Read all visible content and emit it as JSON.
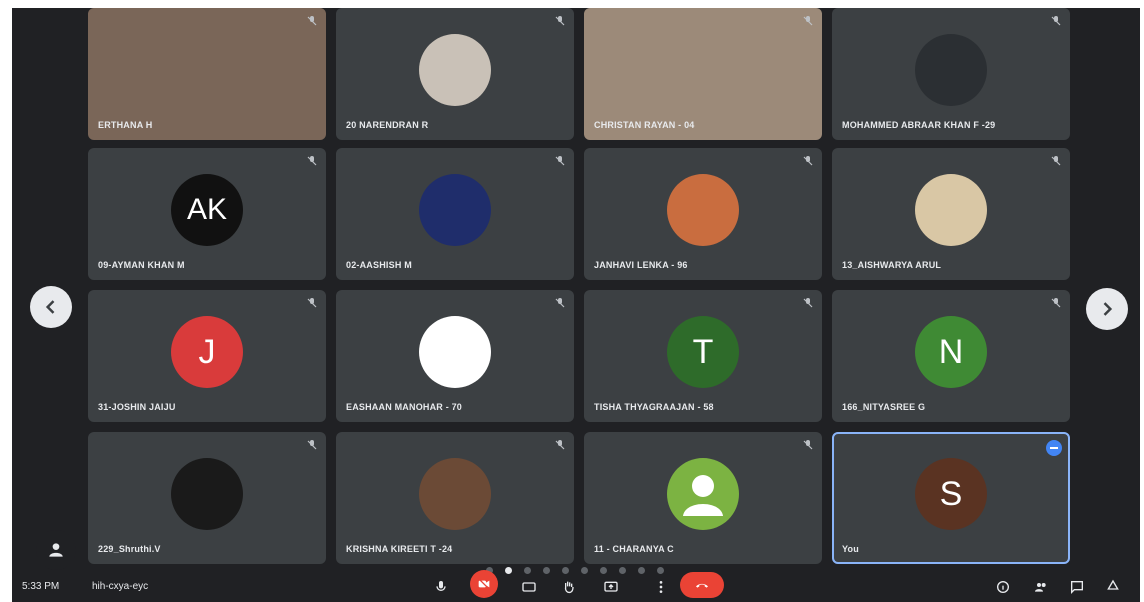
{
  "tiles": [
    {
      "name": "ERTHANA H",
      "kind": "video",
      "color": "#7a6658"
    },
    {
      "name": "20 NARENDRAN R",
      "kind": "photo",
      "avatar_color": "#c9c1b7"
    },
    {
      "name": "CHRISTAN RAYAN - 04",
      "kind": "video",
      "color": "#9c8a79"
    },
    {
      "name": "MOHAMMED ABRAAR KHAN F -29",
      "kind": "photo",
      "avatar_color": "#2b2f33"
    },
    {
      "name": "09-AYMAN KHAN M",
      "kind": "letter",
      "letter": "AK",
      "avatar_color": "#111111"
    },
    {
      "name": "02-AASHISH M",
      "kind": "photo",
      "avatar_color": "#1f2d6b"
    },
    {
      "name": "JANHAVI LENKA - 96",
      "kind": "photo",
      "avatar_color": "#c96d3f"
    },
    {
      "name": "13_AISHWARYA ARUL",
      "kind": "photo",
      "avatar_color": "#d9c7a5"
    },
    {
      "name": "31-JOSHIN JAIJU",
      "kind": "letter",
      "letter": "J",
      "avatar_color": "#d93b3b"
    },
    {
      "name": "EASHAAN MANOHAR - 70",
      "kind": "photo",
      "avatar_color": "#ffffff"
    },
    {
      "name": "TISHA THYAGRAAJAN - 58",
      "kind": "letter",
      "letter": "T",
      "avatar_color": "#2e6b2a"
    },
    {
      "name": "166_NITYASREE G",
      "kind": "letter",
      "letter": "N",
      "avatar_color": "#3f8a34"
    },
    {
      "name": "229_Shruthi.V",
      "kind": "photo",
      "avatar_color": "#1a1a1a"
    },
    {
      "name": "KRISHNA KIREETI T -24",
      "kind": "photo",
      "avatar_color": "#6b4a36"
    },
    {
      "name": "11 - CHARANYA C",
      "kind": "default",
      "avatar_color": "#7cb342"
    },
    {
      "name": "You",
      "kind": "letter",
      "letter": "S",
      "avatar_color": "#5a3322",
      "self": true
    }
  ],
  "bottombar": {
    "time": "5:33 PM",
    "meeting_code": "hih-cxya-eyc"
  },
  "pagination": {
    "count": 10,
    "active": 1
  },
  "colors": {
    "end_call": "#ea4335",
    "accent": "#8ab4f8"
  }
}
